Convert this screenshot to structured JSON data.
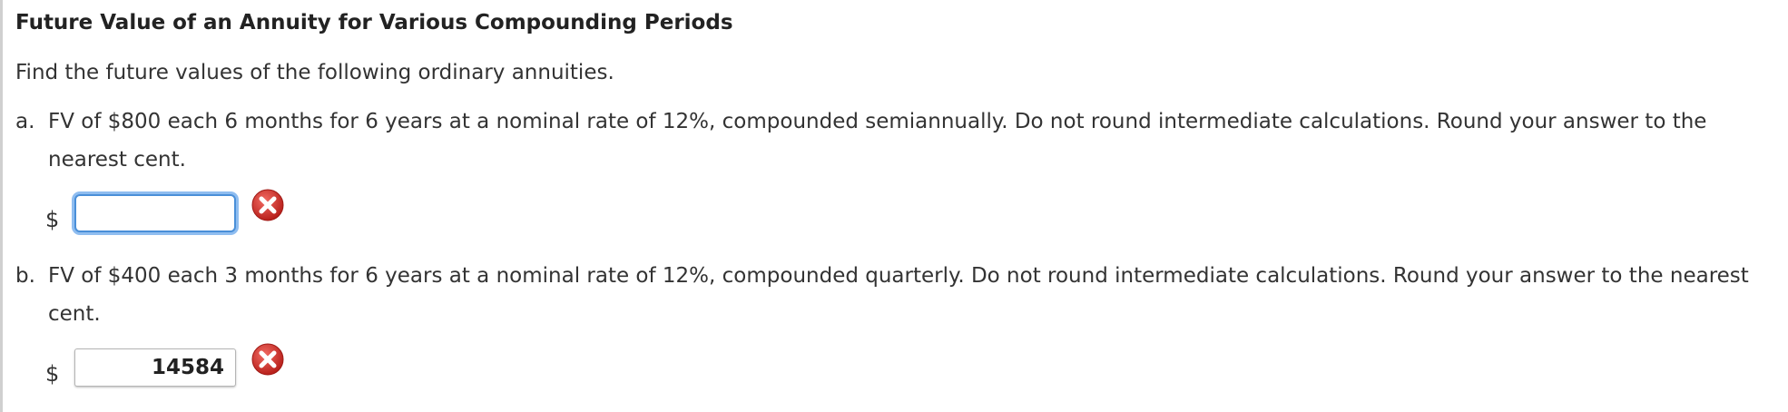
{
  "title": "Future Value of an Annuity for Various Compounding Periods",
  "intro": "Find the future values of the following ordinary annuities.",
  "questions": [
    {
      "letter": "a.",
      "text": "FV of $800 each 6 months for 6 years at a nominal rate of 12%, compounded semiannually. Do not round intermediate calculations. Round your answer to the nearest cent.",
      "currency": "$",
      "answer_value": "",
      "status_icon": "error-x-icon"
    },
    {
      "letter": "b.",
      "text": "FV of $400 each 3 months for 6 years at a nominal rate of 12%, compounded quarterly. Do not round intermediate calculations. Round your answer to the nearest cent.",
      "currency": "$",
      "answer_value": "14584",
      "status_icon": "error-x-icon"
    }
  ],
  "colors": {
    "error_red": "#d0312d",
    "focus_blue": "#4a8fd8"
  }
}
